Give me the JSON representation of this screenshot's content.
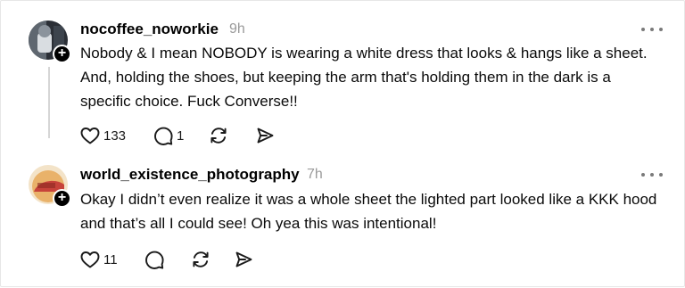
{
  "posts": [
    {
      "username": "nocoffee_noworkie",
      "time": "9h",
      "text": "Nobody & I mean NOBODY is wearing a white dress that looks & hangs like a sheet. And, holding the shoes, but keeping the arm that's holding them in the dark is a specific choice. Fuck Converse!!",
      "likes": "133",
      "replies": "1",
      "reposts": "",
      "avatar_colors": [
        "#2b2f36",
        "#8b939c",
        "#d9dde1"
      ]
    },
    {
      "username": "world_existence_photography",
      "time": "7h",
      "text": "Okay I didn’t even realize it was a whole sheet the lighted part looked like a KKK hood and that’s all I could see! Oh yea this was intentional!",
      "likes": "11",
      "replies": "",
      "reposts": "",
      "avatar_colors": [
        "#c7433a",
        "#e9b26a",
        "#f3e3c8"
      ]
    }
  ],
  "icons": {
    "like": "heart-icon",
    "reply": "comment-icon",
    "repost": "repost-icon",
    "share": "send-icon",
    "more": "more-icon",
    "follow": "plus-icon"
  },
  "colors": {
    "text": "#0a0a0a",
    "muted": "#9a9a9a",
    "thread": "#d6d6d6",
    "icon": "#1a1a1a"
  }
}
